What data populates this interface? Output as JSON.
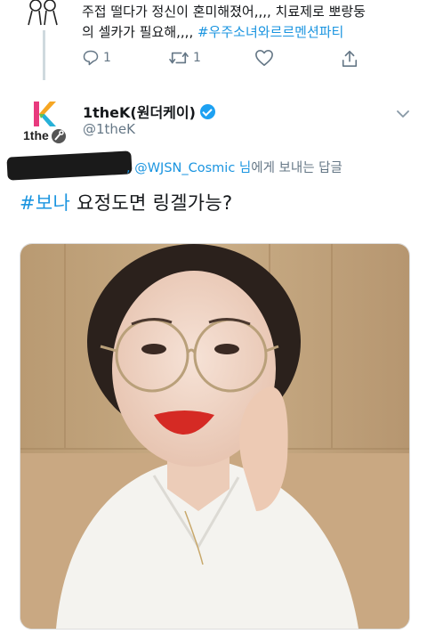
{
  "prev_tweet": {
    "text_line1": "주접 떨다가 정신이 혼미해졌어,,,, 치료제로 뽀랑둥",
    "text_line2_prefix": "의 셀카가 필요해,,,, ",
    "hashtag": "#우주소녀와르르멘션파티",
    "reply_count": "1",
    "retweet_count": "1",
    "avatar_icon": "two-figures-icon"
  },
  "tweet": {
    "display_name": "1theK(원더케이)",
    "handle": "@1theK",
    "avatar_text": "1the",
    "reply_prefix_redacted": "█████님",
    "reply_separator": ", ",
    "reply_mention": "@WJSN_Cosmic",
    "reply_suffix_name": " 님",
    "reply_suffix": "에게 보내는 답글",
    "hashtag": "#보나",
    "text": " 요정도면 링겔가능?"
  },
  "colors": {
    "link": "#1b95e0",
    "text": "#14171a",
    "secondary": "#657786",
    "verified": "#1da1f2"
  }
}
